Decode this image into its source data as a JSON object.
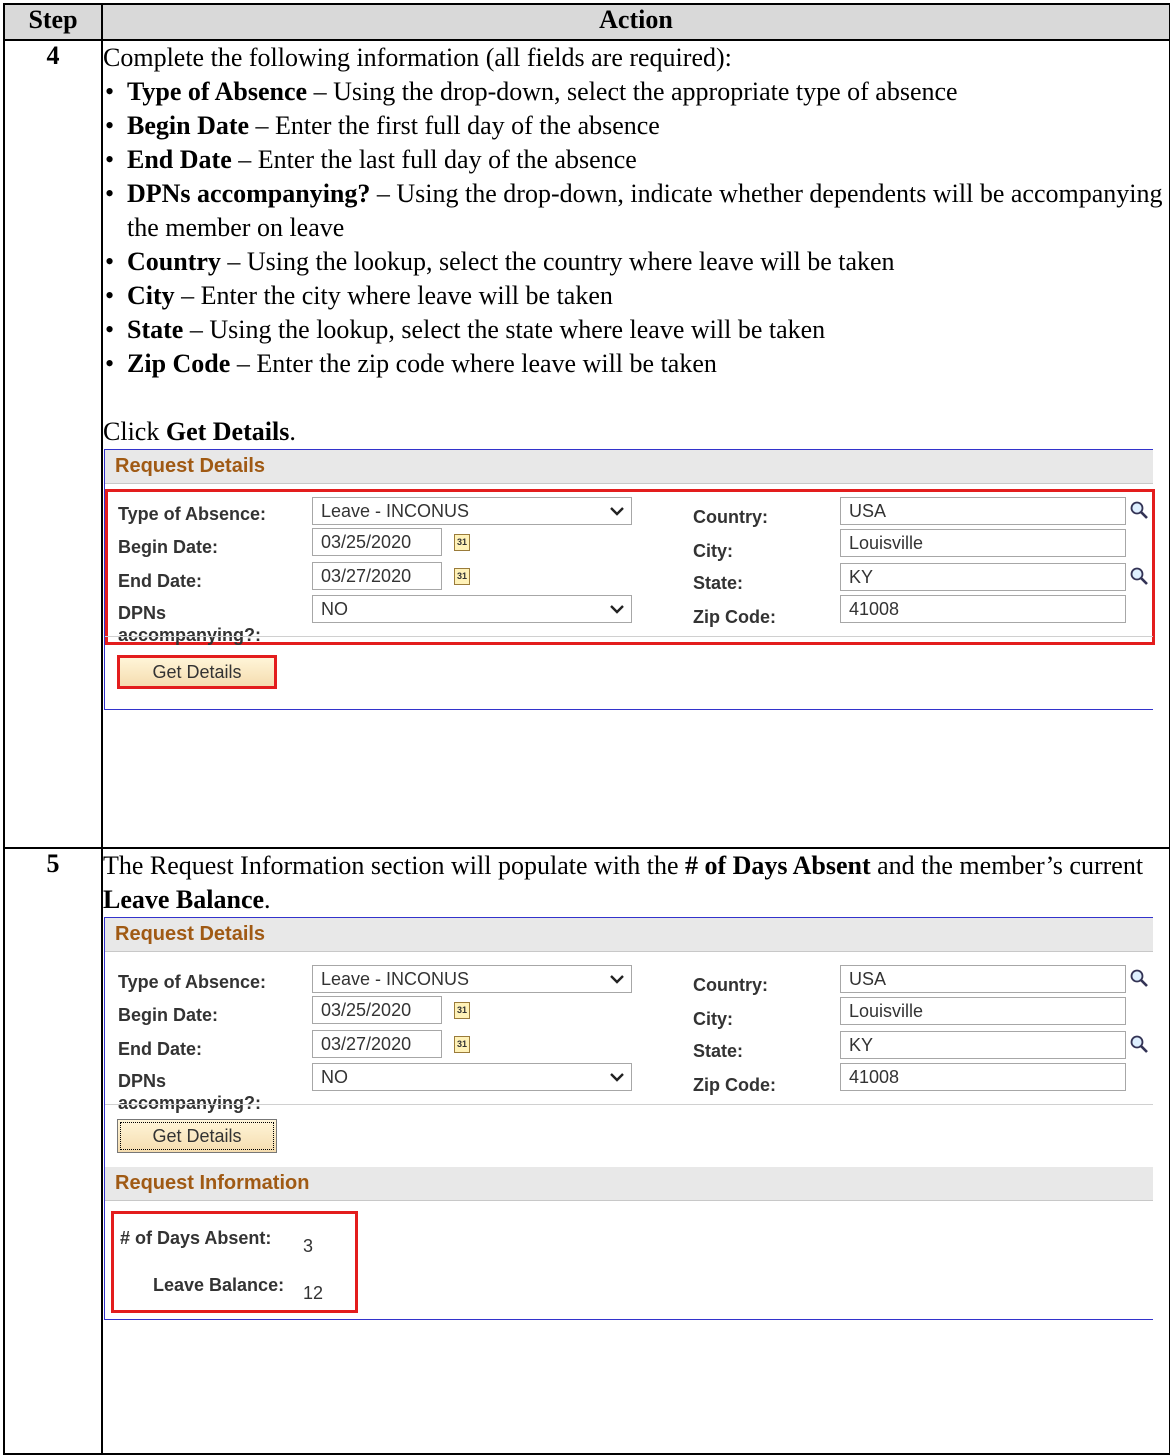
{
  "table": {
    "header_step": "Step",
    "header_action": "Action"
  },
  "step4": {
    "number": "4",
    "intro": "Complete the following information (all fields are required):",
    "bullets": [
      {
        "term": "Type of Absence",
        "text": " – Using the drop-down, select the appropriate type of absence"
      },
      {
        "term": "Begin Date",
        "text": " – Enter the first full day of the absence"
      },
      {
        "term": "End Date",
        "text": " – Enter the last full day of the absence"
      },
      {
        "term": "DPNs accompanying?",
        "text": " – Using the drop-down, indicate whether dependents will be accompanying the member on leave"
      },
      {
        "term": "Country",
        "text": " – Using the lookup, select the country where leave will be taken"
      },
      {
        "term": "City",
        "text": " – Enter the city where leave will be taken"
      },
      {
        "term": "State",
        "text": " – Using the lookup, select the state where leave will be taken"
      },
      {
        "term": "Zip Code",
        "text": " – Enter the zip code where leave will be taken"
      }
    ],
    "click_prefix": "Click ",
    "click_target": "Get Details",
    "click_suffix": "."
  },
  "step5": {
    "number": "5",
    "text1": "The Request Information section will populate with the ",
    "bold1": "# of Days Absent",
    "text2": " and the member’s current ",
    "bold2": "Leave Balance",
    "text3": "."
  },
  "form": {
    "section_title": "Request Details",
    "type_label": "Type of Absence:",
    "type_value": "Leave - INCONUS",
    "begin_label": "Begin Date:",
    "begin_value": "03/25/2020",
    "end_label": "End Date:",
    "end_value": "03/27/2020",
    "dpns_label_1": "DPNs",
    "dpns_label_2": "accompanying?:",
    "dpns_value": "NO",
    "country_label": "Country:",
    "country_value": "USA",
    "city_label": "City:",
    "city_value": "Louisville",
    "state_label": "State:",
    "state_value": "KY",
    "zip_label": "Zip Code:",
    "zip_value": "41008",
    "button_label": "Get Details",
    "calendar_glyph": "31"
  },
  "info": {
    "section_title": "Request Information",
    "days_label": "# of Days Absent:",
    "days_value": "3",
    "balance_label": "Leave Balance:",
    "balance_value": "12"
  },
  "colors": {
    "highlight": "#e31d1d",
    "section_title_text": "#a05a14",
    "panel_border": "#3333cc"
  }
}
